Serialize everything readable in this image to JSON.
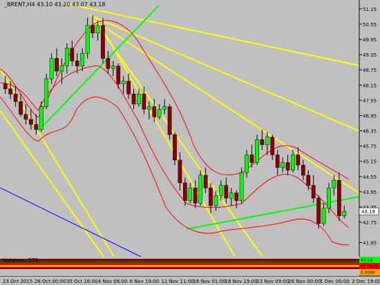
{
  "window": {
    "symbol": "_BRENT,H4",
    "ohlc": "43.10 43.20 43.07 43.18"
  },
  "chart_data": {
    "type": "candlestick",
    "title": "_BRENT,H4",
    "ylim": [
      41.5,
      51.5
    ],
    "price_ticks": [
      "51.15",
      "50.55",
      "49.95",
      "49.35",
      "48.75",
      "48.15",
      "47.55",
      "46.95",
      "46.35",
      "45.75",
      "45.15",
      "44.55",
      "43.95",
      "43.35",
      "42.75",
      "41.95"
    ],
    "current_price": "43.18",
    "time_ticks": [
      "23 Oct 2015",
      "28 Oct 00:00",
      "30 Oct 16:00",
      "4 Nov 08:00",
      "6 Nov 19:00",
      "11 Nov 11:00",
      "16 Nov 01:00",
      "18 Nov 19:00",
      "23 Nov 09:00",
      "26 Nov 00:00",
      "1 Dec 00:00",
      "3 Dec 19:00"
    ],
    "series": [
      {
        "values": [
          {
            "t": 0,
            "o": 48.2,
            "h": 48.5,
            "l": 47.8,
            "c": 48.0
          },
          {
            "t": 1,
            "o": 48.0,
            "h": 48.3,
            "l": 47.6,
            "c": 47.8
          },
          {
            "t": 2,
            "o": 47.8,
            "h": 48.1,
            "l": 47.3,
            "c": 47.5
          },
          {
            "t": 3,
            "o": 47.5,
            "h": 47.8,
            "l": 46.9,
            "c": 47.0
          },
          {
            "t": 4,
            "o": 47.0,
            "h": 47.4,
            "l": 46.6,
            "c": 46.8
          },
          {
            "t": 5,
            "o": 46.8,
            "h": 47.2,
            "l": 46.4,
            "c": 46.6
          },
          {
            "t": 6,
            "o": 46.6,
            "h": 47.0,
            "l": 46.2,
            "c": 46.4
          },
          {
            "t": 7,
            "o": 46.4,
            "h": 47.5,
            "l": 46.3,
            "c": 47.3
          },
          {
            "t": 8,
            "o": 47.3,
            "h": 48.6,
            "l": 47.2,
            "c": 48.4
          },
          {
            "t": 9,
            "o": 48.4,
            "h": 49.4,
            "l": 48.2,
            "c": 49.2
          },
          {
            "t": 10,
            "o": 49.2,
            "h": 49.6,
            "l": 48.5,
            "c": 48.7
          },
          {
            "t": 11,
            "o": 48.7,
            "h": 49.2,
            "l": 48.2,
            "c": 48.9
          },
          {
            "t": 12,
            "o": 48.9,
            "h": 49.8,
            "l": 48.6,
            "c": 49.6
          },
          {
            "t": 13,
            "o": 49.6,
            "h": 49.9,
            "l": 48.9,
            "c": 49.1
          },
          {
            "t": 14,
            "o": 49.1,
            "h": 49.4,
            "l": 48.6,
            "c": 48.9
          },
          {
            "t": 15,
            "o": 48.9,
            "h": 49.6,
            "l": 48.7,
            "c": 49.4
          },
          {
            "t": 16,
            "o": 49.4,
            "h": 50.8,
            "l": 49.2,
            "c": 50.5
          },
          {
            "t": 17,
            "o": 50.5,
            "h": 50.9,
            "l": 50.0,
            "c": 50.2
          },
          {
            "t": 18,
            "o": 50.2,
            "h": 50.7,
            "l": 49.9,
            "c": 50.5
          },
          {
            "t": 19,
            "o": 50.5,
            "h": 50.8,
            "l": 49.0,
            "c": 49.2
          },
          {
            "t": 20,
            "o": 49.2,
            "h": 49.5,
            "l": 48.6,
            "c": 48.8
          },
          {
            "t": 21,
            "o": 48.8,
            "h": 49.1,
            "l": 48.5,
            "c": 48.9
          },
          {
            "t": 22,
            "o": 48.9,
            "h": 49.0,
            "l": 48.0,
            "c": 48.2
          },
          {
            "t": 23,
            "o": 48.2,
            "h": 48.5,
            "l": 47.8,
            "c": 48.3
          },
          {
            "t": 24,
            "o": 48.3,
            "h": 48.6,
            "l": 47.6,
            "c": 47.8
          },
          {
            "t": 25,
            "o": 47.8,
            "h": 48.0,
            "l": 47.2,
            "c": 47.4
          },
          {
            "t": 26,
            "o": 47.4,
            "h": 48.0,
            "l": 47.3,
            "c": 47.8
          },
          {
            "t": 27,
            "o": 47.8,
            "h": 48.1,
            "l": 47.0,
            "c": 47.2
          },
          {
            "t": 28,
            "o": 47.2,
            "h": 47.5,
            "l": 46.8,
            "c": 47.3
          },
          {
            "t": 29,
            "o": 47.3,
            "h": 47.6,
            "l": 46.7,
            "c": 46.9
          },
          {
            "t": 30,
            "o": 46.9,
            "h": 47.4,
            "l": 46.8,
            "c": 47.2
          },
          {
            "t": 31,
            "o": 47.2,
            "h": 47.6,
            "l": 47.0,
            "c": 47.3
          },
          {
            "t": 32,
            "o": 47.3,
            "h": 47.4,
            "l": 46.0,
            "c": 46.2
          },
          {
            "t": 33,
            "o": 46.2,
            "h": 46.3,
            "l": 45.0,
            "c": 45.2
          },
          {
            "t": 34,
            "o": 45.2,
            "h": 45.5,
            "l": 44.0,
            "c": 44.3
          },
          {
            "t": 35,
            "o": 44.3,
            "h": 44.5,
            "l": 43.4,
            "c": 43.6
          },
          {
            "t": 36,
            "o": 43.6,
            "h": 44.3,
            "l": 43.5,
            "c": 44.1
          },
          {
            "t": 37,
            "o": 44.1,
            "h": 44.4,
            "l": 43.3,
            "c": 43.5
          },
          {
            "t": 38,
            "o": 43.5,
            "h": 44.8,
            "l": 43.4,
            "c": 44.6
          },
          {
            "t": 39,
            "o": 44.6,
            "h": 44.9,
            "l": 43.9,
            "c": 44.1
          },
          {
            "t": 40,
            "o": 44.1,
            "h": 44.3,
            "l": 43.1,
            "c": 43.4
          },
          {
            "t": 41,
            "o": 43.4,
            "h": 44.0,
            "l": 43.2,
            "c": 43.8
          },
          {
            "t": 42,
            "o": 43.8,
            "h": 44.4,
            "l": 43.6,
            "c": 44.2
          },
          {
            "t": 43,
            "o": 44.2,
            "h": 44.5,
            "l": 43.5,
            "c": 43.7
          },
          {
            "t": 44,
            "o": 43.7,
            "h": 44.1,
            "l": 43.4,
            "c": 43.9
          },
          {
            "t": 45,
            "o": 43.9,
            "h": 44.0,
            "l": 43.3,
            "c": 43.6
          },
          {
            "t": 46,
            "o": 43.6,
            "h": 44.9,
            "l": 43.5,
            "c": 44.7
          },
          {
            "t": 47,
            "o": 44.7,
            "h": 45.6,
            "l": 44.5,
            "c": 45.4
          },
          {
            "t": 48,
            "o": 45.4,
            "h": 45.8,
            "l": 44.9,
            "c": 45.1
          },
          {
            "t": 49,
            "o": 45.1,
            "h": 46.2,
            "l": 45.0,
            "c": 46.0
          },
          {
            "t": 50,
            "o": 46.0,
            "h": 46.4,
            "l": 45.6,
            "c": 45.8
          },
          {
            "t": 51,
            "o": 45.8,
            "h": 46.3,
            "l": 45.4,
            "c": 46.1
          },
          {
            "t": 52,
            "o": 46.1,
            "h": 46.2,
            "l": 45.2,
            "c": 45.4
          },
          {
            "t": 53,
            "o": 45.4,
            "h": 45.6,
            "l": 44.6,
            "c": 44.9
          },
          {
            "t": 54,
            "o": 44.9,
            "h": 45.3,
            "l": 44.7,
            "c": 45.1
          },
          {
            "t": 55,
            "o": 45.1,
            "h": 45.4,
            "l": 44.6,
            "c": 44.8
          },
          {
            "t": 56,
            "o": 44.8,
            "h": 45.6,
            "l": 44.7,
            "c": 45.4
          },
          {
            "t": 57,
            "o": 45.4,
            "h": 45.7,
            "l": 44.8,
            "c": 45.0
          },
          {
            "t": 58,
            "o": 45.0,
            "h": 45.2,
            "l": 44.4,
            "c": 44.6
          },
          {
            "t": 59,
            "o": 44.6,
            "h": 44.8,
            "l": 44.0,
            "c": 44.2
          },
          {
            "t": 60,
            "o": 44.2,
            "h": 44.6,
            "l": 43.5,
            "c": 43.7
          },
          {
            "t": 61,
            "o": 43.7,
            "h": 43.8,
            "l": 42.5,
            "c": 42.7
          },
          {
            "t": 62,
            "o": 42.7,
            "h": 43.5,
            "l": 42.6,
            "c": 43.3
          },
          {
            "t": 63,
            "o": 43.3,
            "h": 44.3,
            "l": 43.1,
            "c": 44.1
          },
          {
            "t": 64,
            "o": 44.1,
            "h": 44.6,
            "l": 43.8,
            "c": 44.4
          },
          {
            "t": 65,
            "o": 44.4,
            "h": 44.7,
            "l": 42.8,
            "c": 43.0
          },
          {
            "t": 66,
            "o": 43.0,
            "h": 43.4,
            "l": 42.9,
            "c": 43.18
          }
        ]
      }
    ],
    "volume_label": "Volumes 272",
    "volume_badges": [
      "43.18",
      "91.0926",
      "0.0000"
    ]
  }
}
